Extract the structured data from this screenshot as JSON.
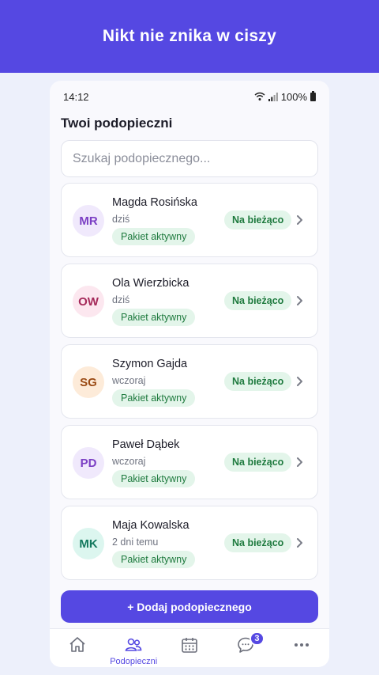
{
  "hero": {
    "title": "Nikt nie znika w ciszy"
  },
  "status_bar": {
    "time": "14:12",
    "battery": "100%"
  },
  "section_title": "Twoi podopieczni",
  "search": {
    "placeholder": "Szukaj podopiecznego..."
  },
  "clients": [
    {
      "initials": "MR",
      "name": "Magda Rosińska",
      "last_seen": "dziś",
      "package": "Pakiet aktywny",
      "status": "Na bieżąco",
      "avatar_bg": "#f0e9fc",
      "avatar_fg": "#7b3fc4"
    },
    {
      "initials": "OW",
      "name": "Ola Wierzbicka",
      "last_seen": "dziś",
      "package": "Pakiet aktywny",
      "status": "Na bieżąco",
      "avatar_bg": "#fce7ef",
      "avatar_fg": "#a52a5a"
    },
    {
      "initials": "SG",
      "name": "Szymon Gajda",
      "last_seen": "wczoraj",
      "package": "Pakiet aktywny",
      "status": "Na bieżąco",
      "avatar_bg": "#fdebd9",
      "avatar_fg": "#9a4a14"
    },
    {
      "initials": "PD",
      "name": "Paweł Dąbek",
      "last_seen": "wczoraj",
      "package": "Pakiet aktywny",
      "status": "Na bieżąco",
      "avatar_bg": "#f0e9fc",
      "avatar_fg": "#7b3fc4"
    },
    {
      "initials": "MK",
      "name": "Maja Kowalska",
      "last_seen": "2 dni temu",
      "package": "Pakiet aktywny",
      "status": "Na bieżąco",
      "avatar_bg": "#dcf6ef",
      "avatar_fg": "#14795e"
    }
  ],
  "add_button": {
    "label": "+ Dodaj podopiecznego"
  },
  "nav": {
    "home_icon": "home-icon",
    "clients_label": "Podopieczni",
    "calendar_icon": "calendar-icon",
    "messages_badge": "3",
    "more_icon": "more-icon"
  },
  "colors": {
    "accent": "#5548e2",
    "success_bg": "#e3f5ea",
    "success_fg": "#1e7a3e"
  }
}
